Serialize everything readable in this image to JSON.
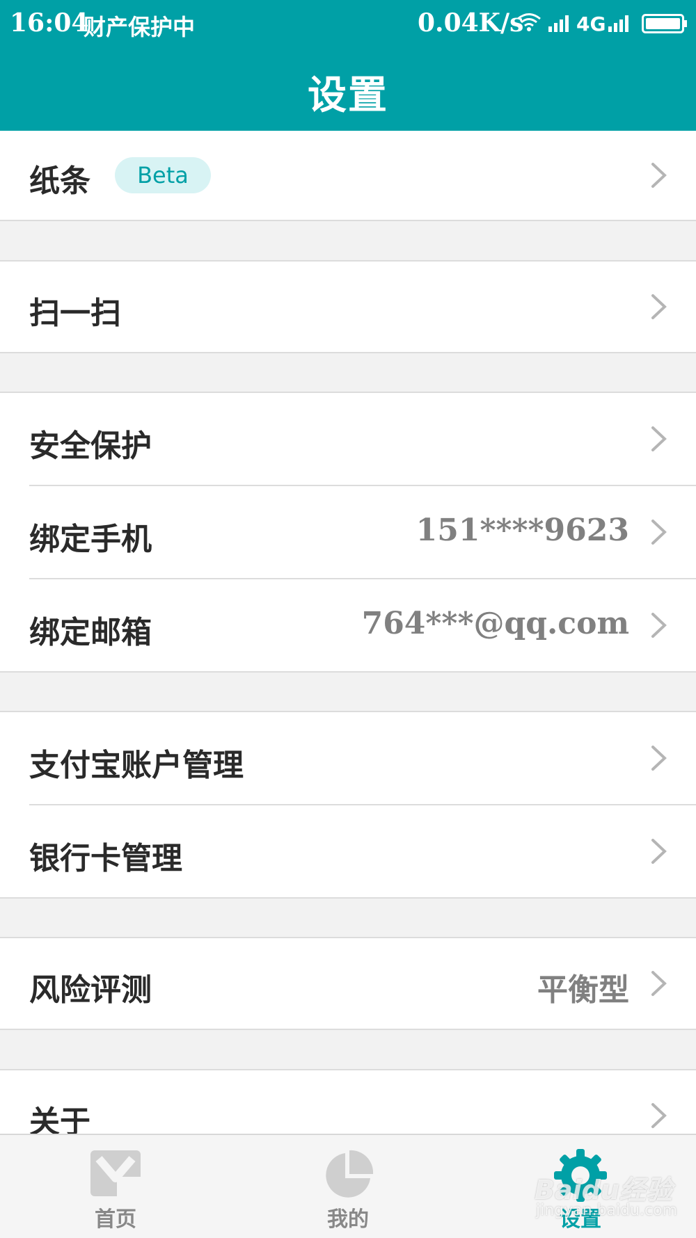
{
  "status_bar": {
    "time": "16:04",
    "mode": "财产保护中",
    "speed": "0.04K/s",
    "network": "4G"
  },
  "header": {
    "title": "设置"
  },
  "items": {
    "note": {
      "label": "纸条",
      "badge": "Beta"
    },
    "scan": {
      "label": "扫一扫"
    },
    "security": {
      "label": "安全保护"
    },
    "phone": {
      "label": "绑定手机",
      "value": "151****9623"
    },
    "email": {
      "label": "绑定邮箱",
      "value": "764***@qq.com"
    },
    "alipay": {
      "label": "支付宝账户管理"
    },
    "bankcard": {
      "label": "银行卡管理"
    },
    "risk": {
      "label": "风险评测",
      "value": "平衡型"
    },
    "about": {
      "label": "关于"
    }
  },
  "tabs": [
    {
      "label": "首页",
      "icon": "m-logo-icon",
      "active": false
    },
    {
      "label": "我的",
      "icon": "pie-chart-icon",
      "active": false
    },
    {
      "label": "设置",
      "icon": "gear-icon",
      "active": true
    }
  ],
  "watermark": {
    "main": "Baidu经验",
    "sub": "jingyan.baidu.com"
  },
  "colors": {
    "accent": "#00a0a6",
    "background": "#f2f2f2",
    "value_text": "#808080",
    "badge_bg": "#d8f3f4"
  }
}
